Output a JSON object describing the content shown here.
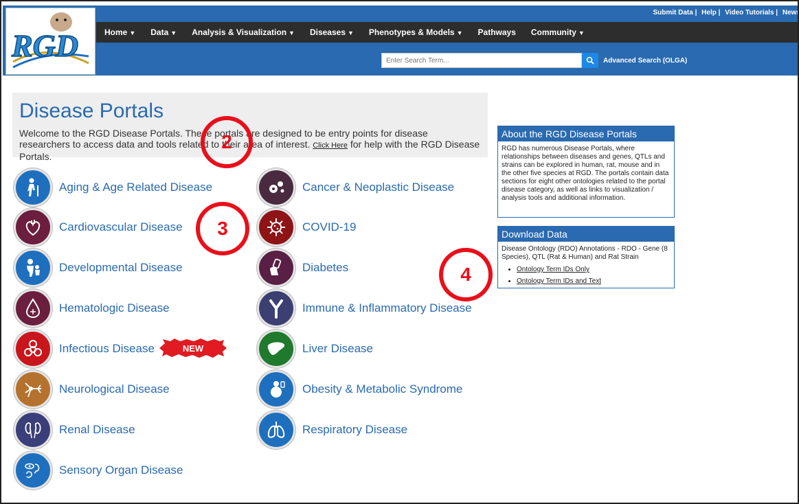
{
  "header": {
    "top_links": [
      "Submit Data",
      "Help",
      "Video Tutorials",
      "News"
    ],
    "nav": [
      {
        "label": "Home",
        "dropdown": true
      },
      {
        "label": "Data",
        "dropdown": true
      },
      {
        "label": "Analysis & Visualization",
        "dropdown": true
      },
      {
        "label": "Diseases",
        "dropdown": true
      },
      {
        "label": "Phenotypes & Models",
        "dropdown": true
      },
      {
        "label": "Pathways",
        "dropdown": false
      },
      {
        "label": "Community",
        "dropdown": true
      }
    ],
    "search_placeholder": "Enter Search Term...",
    "advanced_search": "Advanced Search (OLGA)",
    "logo_text": "RGD"
  },
  "intro": {
    "title": "Disease Portals",
    "text": "Welcome to the RGD Disease Portals. These portals are designed to be entry points for disease researchers to access data and tools related to their area of interest.",
    "click_here": "Click Here",
    "text_after": "for help with the RGD Disease Portals."
  },
  "portals_left": [
    {
      "label": "Aging & Age Related Disease",
      "icon": "elderly-icon",
      "color": "#1f6fbf"
    },
    {
      "label": "Cardiovascular Disease",
      "icon": "heart-icon",
      "color": "#6b1e3e"
    },
    {
      "label": "Developmental Disease",
      "icon": "child-icon",
      "color": "#1f6fbf"
    },
    {
      "label": "Hematologic Disease",
      "icon": "blood-drop-icon",
      "color": "#6b1e3e"
    },
    {
      "label": "Infectious Disease",
      "icon": "biohazard-icon",
      "color": "#c9161c"
    },
    {
      "label": "Neurological Disease",
      "icon": "neuron-icon",
      "color": "#b5722e"
    },
    {
      "label": "Renal Disease",
      "icon": "kidney-icon",
      "color": "#3a3f7a"
    },
    {
      "label": "Sensory Organ Disease",
      "icon": "sensory-organ-icon",
      "color": "#1f6fbf"
    }
  ],
  "portals_right": [
    {
      "label": "Cancer & Neoplastic Disease",
      "icon": "cancer-cell-icon",
      "color": "#4a2a3e"
    },
    {
      "label": "COVID-19",
      "icon": "virus-icon",
      "color": "#8e1416"
    },
    {
      "label": "Diabetes",
      "icon": "insulin-icon",
      "color": "#5a1f44"
    },
    {
      "label": "Immune & Inflammatory Disease",
      "icon": "antibody-icon",
      "color": "#3b3f72"
    },
    {
      "label": "Liver Disease",
      "icon": "liver-icon",
      "color": "#1f7a2e"
    },
    {
      "label": "Obesity & Metabolic Syndrome",
      "icon": "obesity-icon",
      "color": "#1f6fbf"
    },
    {
      "label": "Respiratory Disease",
      "icon": "lungs-icon",
      "color": "#1f6fbf"
    }
  ],
  "new_badge": "NEW",
  "annotations": [
    "2",
    "3",
    "4"
  ],
  "about_box": {
    "title": "About the RGD Disease Portals",
    "body": "RGD has numerous Disease Portals, where relationships between diseases and genes, QTLs and strains can be explored in human, rat, mouse and in the other five species at RGD. The portals contain data sections for eight other ontologies related to the portal disease category, as well as links to visualization / analysis tools and additional information."
  },
  "download_box": {
    "title": "Download Data",
    "body": "Disease Ontology (RDO) Annotations - RDO - Gene (8 Species), QTL (Rat & Human) and Rat Strain",
    "links": [
      "Ontology Term IDs Only",
      "Ontology Term IDs and Text"
    ]
  }
}
